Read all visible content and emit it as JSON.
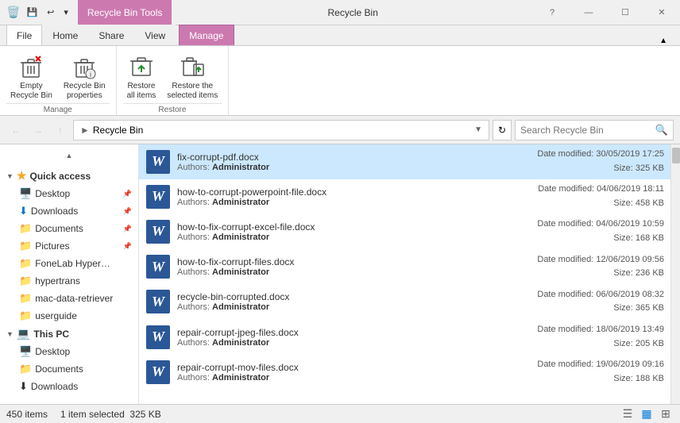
{
  "titlebar": {
    "title": "Recycle Bin",
    "ribbon_tab_label": "Recycle Bin Tools",
    "minimize": "—",
    "maximize": "☐",
    "close": "✕"
  },
  "tabs": {
    "file": "File",
    "home": "Home",
    "share": "Share",
    "view": "View",
    "manage": "Manage"
  },
  "ribbon": {
    "empty_label": "Empty\nRecycle Bin",
    "properties_label": "Recycle Bin\nproperties",
    "restore_all_label": "Restore\nall items",
    "restore_selected_label": "Restore the\nselected items",
    "group_manage": "Manage",
    "group_restore": "Restore"
  },
  "addressbar": {
    "path": "Recycle Bin",
    "search_placeholder": "Search Recycle Bin"
  },
  "sidebar": {
    "quick_access": "Quick access",
    "desktop": "Desktop",
    "downloads": "Downloads",
    "documents": "Documents",
    "pictures": "Pictures",
    "fonelab": "FoneLab HyperTrans...",
    "hypertrans": "hypertrans",
    "mac_data": "mac-data-retriever",
    "userguide": "userguide",
    "this_pc": "This PC",
    "desktop2": "Desktop",
    "documents2": "Documents",
    "downloads2": "Downloads"
  },
  "files": [
    {
      "name": "fix-corrupt-pdf.docx",
      "author": "Administrator",
      "date_modified": "Date modified: 30/05/2019 17:25",
      "size": "Size: 325 KB",
      "selected": true
    },
    {
      "name": "how-to-corrupt-powerpoint-file.docx",
      "author": "Administrator",
      "date_modified": "Date modified: 04/06/2019 18:11",
      "size": "Size: 458 KB",
      "selected": false
    },
    {
      "name": "how-to-fix-corrupt-excel-file.docx",
      "author": "Administrator",
      "date_modified": "Date modified: 04/06/2019 10:59",
      "size": "Size: 168 KB",
      "selected": false
    },
    {
      "name": "how-to-fix-corrupt-files.docx",
      "author": "Administrator",
      "date_modified": "Date modified: 12/06/2019 09:56",
      "size": "Size: 236 KB",
      "selected": false
    },
    {
      "name": "recycle-bin-corrupted.docx",
      "author": "Administrator",
      "date_modified": "Date modified: 06/06/2019 08:32",
      "size": "Size: 365 KB",
      "selected": false
    },
    {
      "name": "repair-corrupt-jpeg-files.docx",
      "author": "Administrator",
      "date_modified": "Date modified: 18/06/2019 13:49",
      "size": "Size: 205 KB",
      "selected": false
    },
    {
      "name": "repair-corrupt-mov-files.docx",
      "author": "Administrator",
      "date_modified": "Date modified: 19/06/2019 09:16",
      "size": "Size: 188 KB",
      "selected": false
    }
  ],
  "statusbar": {
    "item_count": "450 items",
    "selected": "1 item selected",
    "size": "325 KB"
  },
  "authors_label": "Authors:"
}
